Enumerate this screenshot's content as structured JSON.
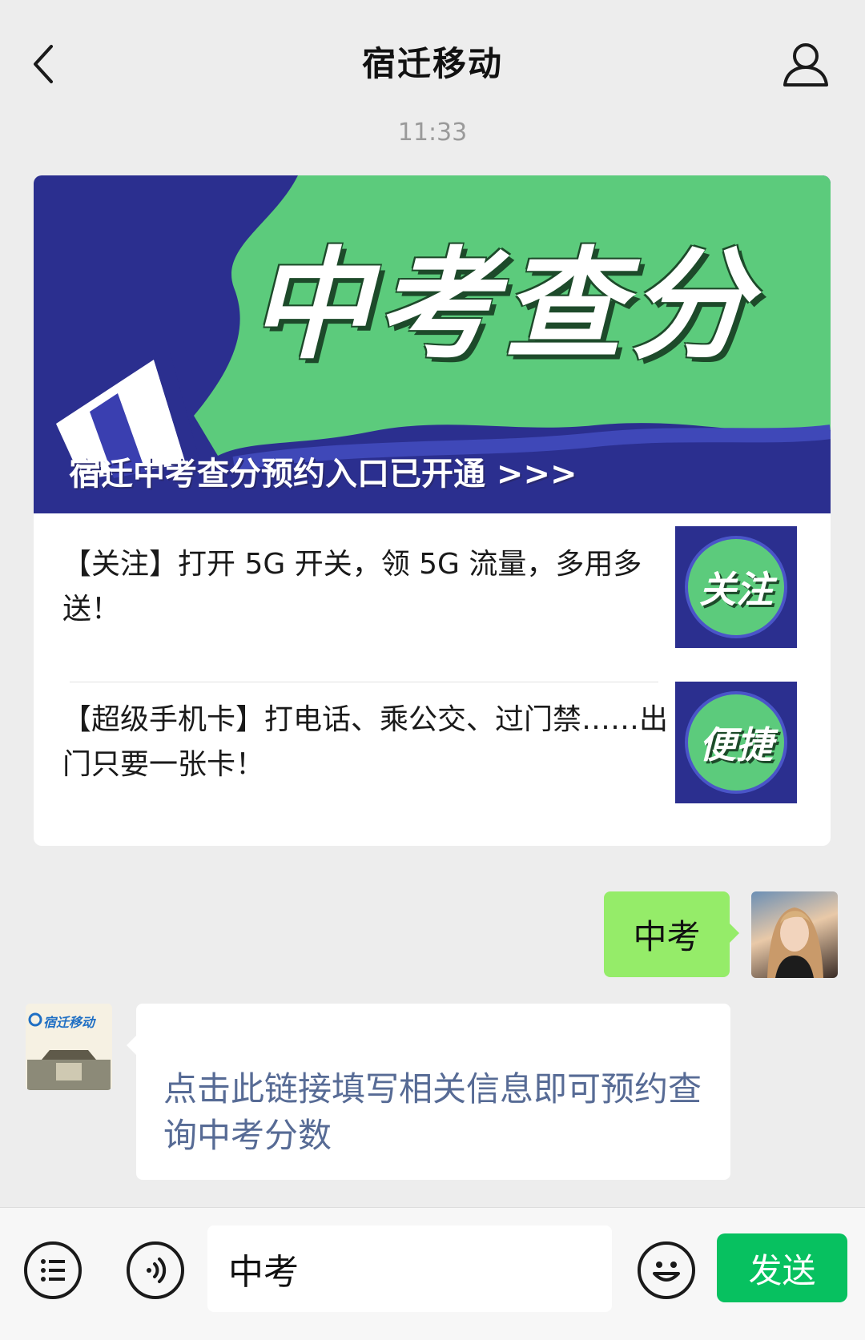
{
  "header": {
    "title": "宿迁移动",
    "timestamp": "11:33"
  },
  "article": {
    "banner_headline": "中考查分",
    "banner_caption": "宿迁中考查分预约入口已开通 >>>",
    "items": [
      {
        "text": "【关注】打开 5G 开关，领 5G 流量，多用多送！",
        "thumb_label": "关注"
      },
      {
        "text": "【超级手机卡】打电话、乘公交、过门禁……出门只要一张卡！",
        "thumb_label": "便捷"
      }
    ]
  },
  "messages": {
    "outgoing_text": "中考",
    "incoming_link_text": "点击此链接填写相关信息即可预约查询中考分数",
    "mobile_avatar_text": "宿迁移动"
  },
  "input_bar": {
    "input_value": "中考",
    "send_label": "发送"
  },
  "colors": {
    "accent": "#07c160",
    "bubble_out": "#95ec69",
    "link": "#576b95",
    "banner_navy": "#2b2f8f",
    "banner_green": "#5ccb7c"
  },
  "icons": [
    "back-chevron-icon",
    "profile-icon",
    "menu-list-icon",
    "voice-icon",
    "emoji-icon",
    "megaphone-icon"
  ]
}
